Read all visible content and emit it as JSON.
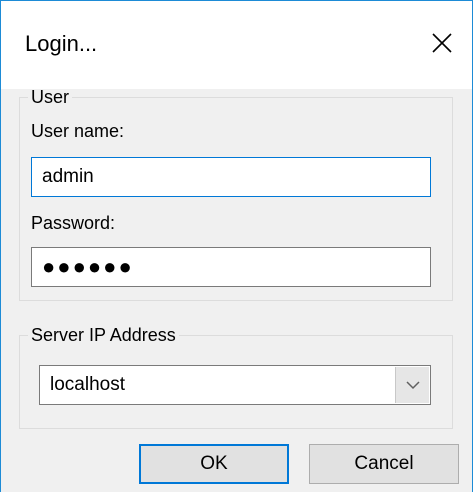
{
  "window": {
    "title": "Login..."
  },
  "user_group": {
    "legend": "User",
    "username_label": "User name:",
    "username_value": "admin",
    "password_label": "Password:",
    "password_masked": "●●●●●●"
  },
  "server_group": {
    "legend": "Server IP Address",
    "selected": "localhost"
  },
  "buttons": {
    "ok": "OK",
    "cancel": "Cancel"
  },
  "colors": {
    "accent": "#0078d7",
    "dialog_bg": "#f0f0f0",
    "button_bg": "#e1e1e1"
  },
  "icons": {
    "close": "close-icon",
    "dropdown": "chevron-down-icon"
  }
}
